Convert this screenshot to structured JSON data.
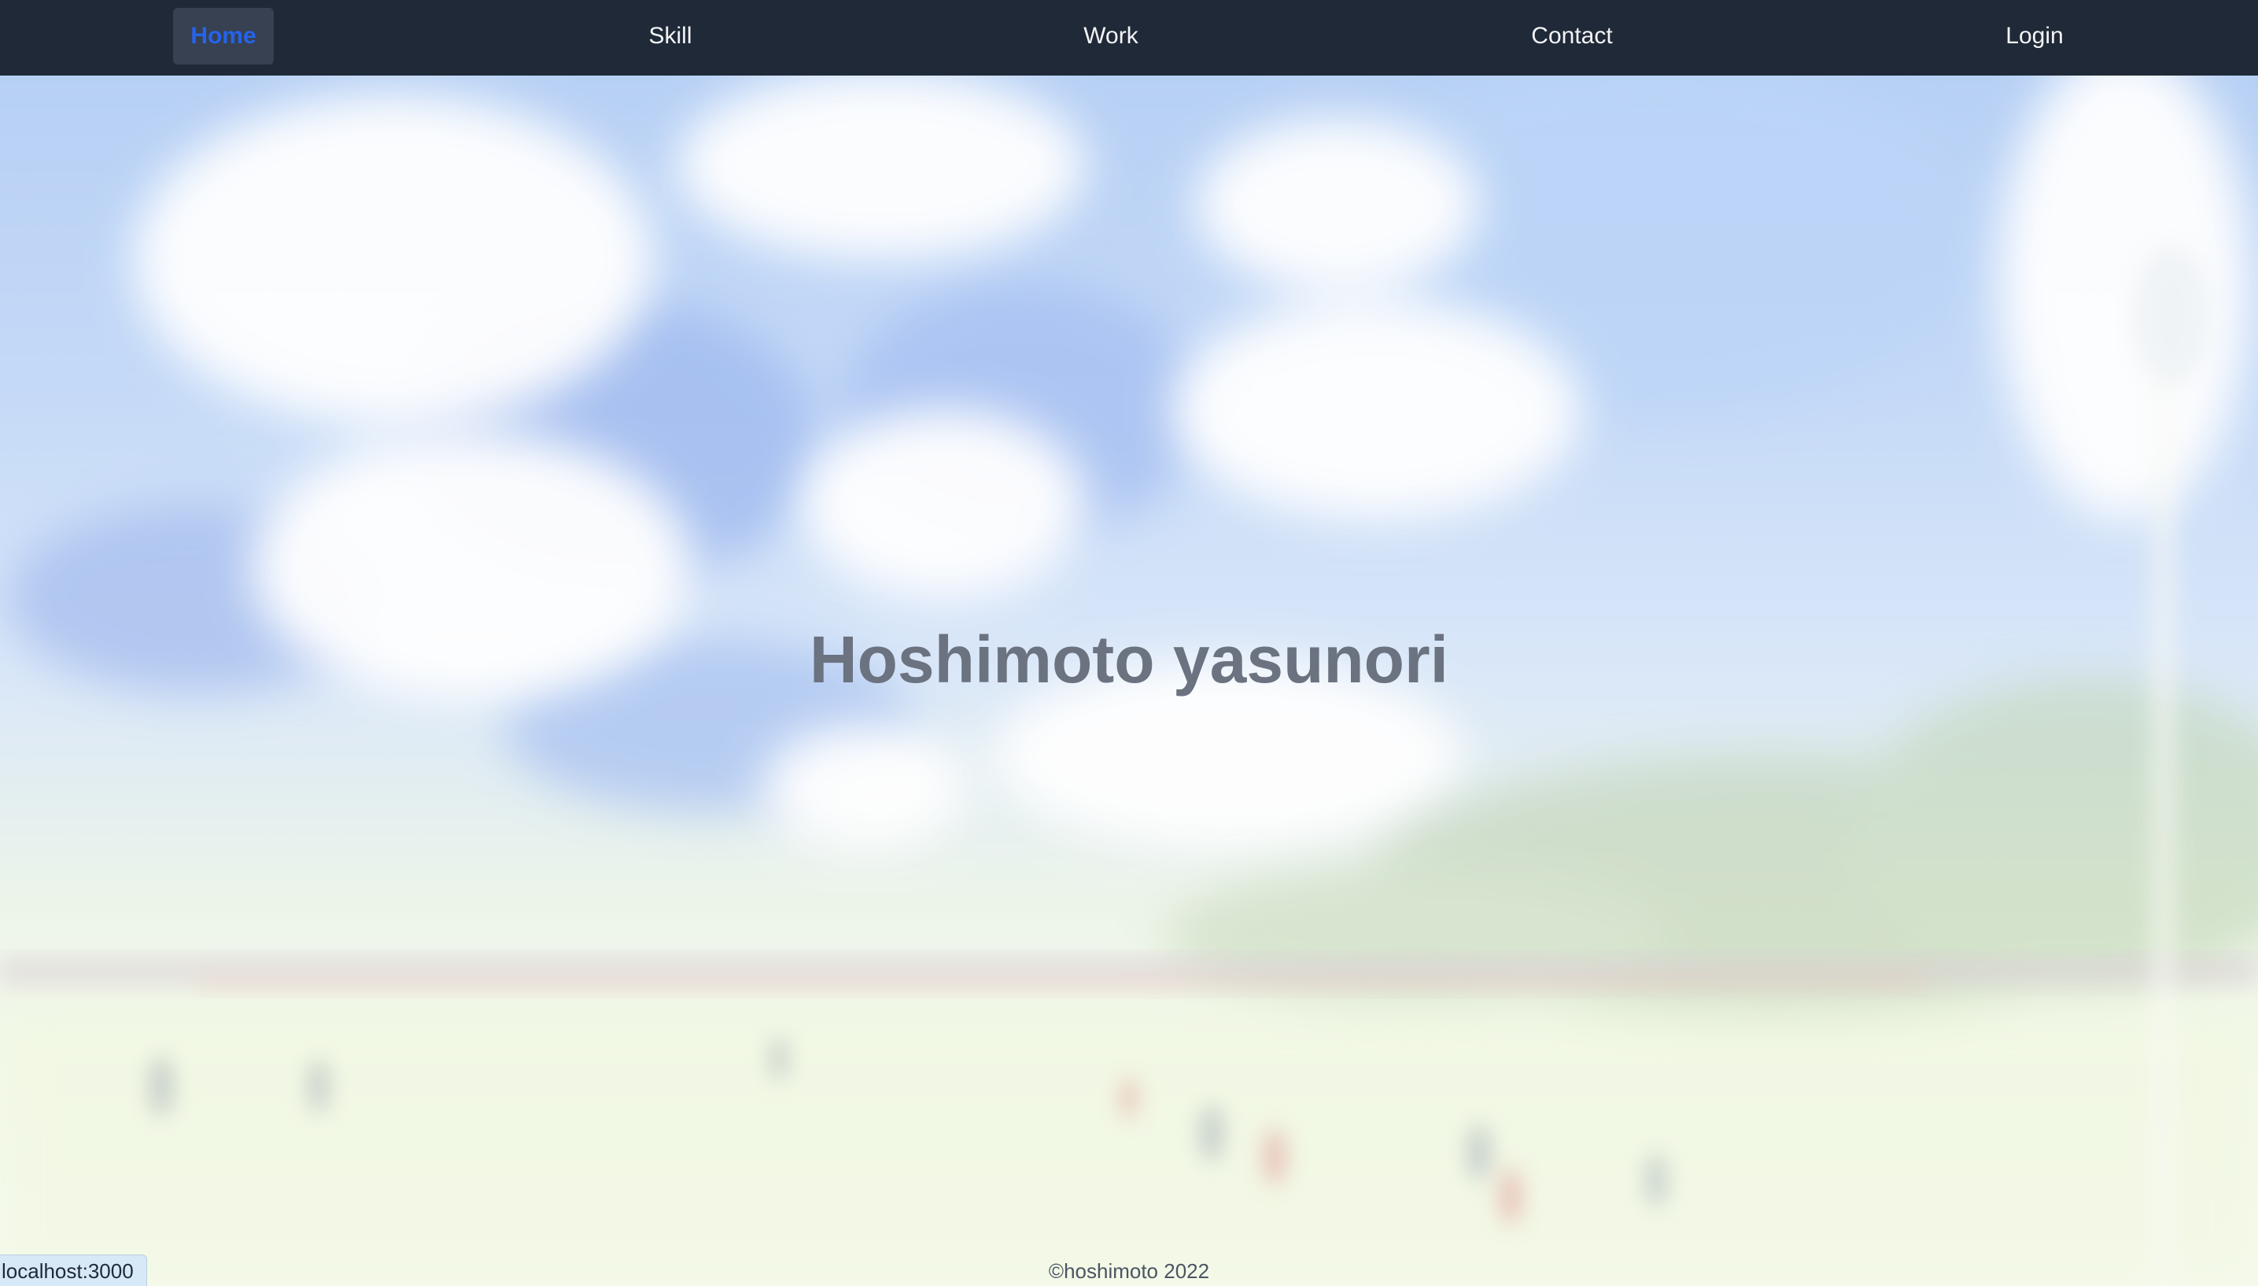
{
  "nav": {
    "items": [
      {
        "label": "Home",
        "active": true
      },
      {
        "label": "Skill",
        "active": false
      },
      {
        "label": "Work",
        "active": false
      },
      {
        "label": "Contact",
        "active": false
      },
      {
        "label": "Login",
        "active": false
      }
    ]
  },
  "hero": {
    "title": "Hoshimoto yasunori"
  },
  "footer": {
    "copyright": "©hoshimoto 2022"
  },
  "status_bar": {
    "url": "localhost:3000"
  },
  "colors": {
    "navbar_bg": "#1f2937",
    "nav_text": "#f3f4f6",
    "nav_active_text": "#2563eb",
    "nav_active_bg": "#374151",
    "hero_title": "#6b7280"
  }
}
